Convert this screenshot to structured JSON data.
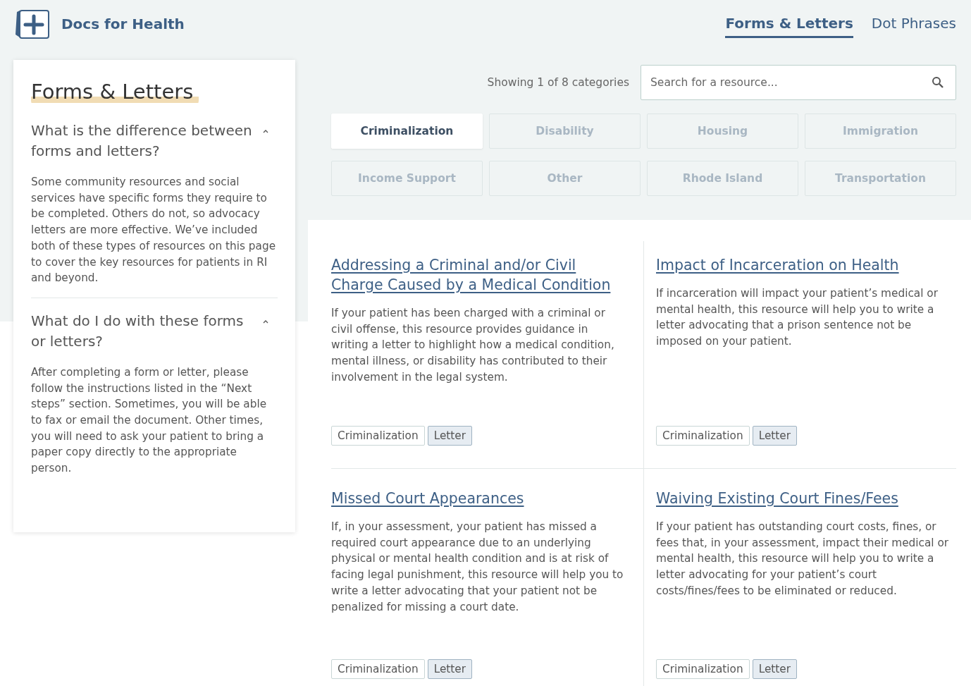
{
  "header": {
    "brand": "Docs for Health",
    "nav": [
      {
        "label": "Forms & Letters",
        "selected": true
      },
      {
        "label": "Dot Phrases",
        "selected": false
      }
    ]
  },
  "sidebar": {
    "title": "Forms & Letters",
    "faq": [
      {
        "question": "What is the difference between forms and letters?",
        "expanded": true,
        "answer": "Some community resources and social services have specific forms they require to be completed. Others do not, so advocacy letters are more effective. We’ve included both of these types of resources on this page to cover the key resources for patients in RI and beyond."
      },
      {
        "question": "What do I do with these forms or letters?",
        "expanded": true,
        "answer": "After completing a form or letter, please follow the instructions listed in the “Next steps” section. Sometimes, you will be able to fax or email the document. Other times, you will need to ask your patient to bring a paper copy directly to the appropriate person."
      }
    ]
  },
  "filter": {
    "count_text": "Showing 1 of 8 categories",
    "search": {
      "placeholder": "Search for a resource..."
    },
    "categories": [
      {
        "label": "Criminalization",
        "selected": true
      },
      {
        "label": "Disability",
        "selected": false
      },
      {
        "label": "Housing",
        "selected": false
      },
      {
        "label": "Immigration",
        "selected": false
      },
      {
        "label": "Income Support",
        "selected": false
      },
      {
        "label": "Other",
        "selected": false
      },
      {
        "label": "Rhode Island",
        "selected": false
      },
      {
        "label": "Transportation",
        "selected": false
      }
    ]
  },
  "resources": [
    {
      "title": "Addressing a Criminal and/or Civil Charge Caused by a Medical Condition",
      "description": "If your patient has been charged with a criminal or civil offense, this resource provides guidance in writing a letter to highlight how a medical condition, mental illness, or disability has contributed to their involvement in the legal system.",
      "tags": [
        {
          "label": "Criminalization",
          "kind": "category"
        },
        {
          "label": "Letter",
          "kind": "type"
        }
      ]
    },
    {
      "title": "Impact of Incarceration on Health",
      "description": "If incarceration will impact your patient’s medical or mental health, this resource will help you to write a letter advocating that a prison sentence not be imposed on your patient.",
      "tags": [
        {
          "label": "Criminalization",
          "kind": "category"
        },
        {
          "label": "Letter",
          "kind": "type"
        }
      ]
    },
    {
      "title": "Missed Court Appearances",
      "description": "If, in your assessment, your patient has missed a required court appearance due to an underlying physical or mental health condition and is at risk of facing legal punishment, this resource will help you to write a letter advocating that your patient not be penalized for missing a court date.",
      "tags": [
        {
          "label": "Criminalization",
          "kind": "category"
        },
        {
          "label": "Letter",
          "kind": "type"
        }
      ]
    },
    {
      "title": "Waiving Existing Court Fines/Fees",
      "description": "If your patient has outstanding court costs, fines, or fees that, in your assessment, impact their medical or mental health, this resource will help you to write a letter advocating for your patient’s court costs/fines/fees to be eliminated or reduced.",
      "tags": [
        {
          "label": "Criminalization",
          "kind": "category"
        },
        {
          "label": "Letter",
          "kind": "type"
        }
      ]
    }
  ]
}
